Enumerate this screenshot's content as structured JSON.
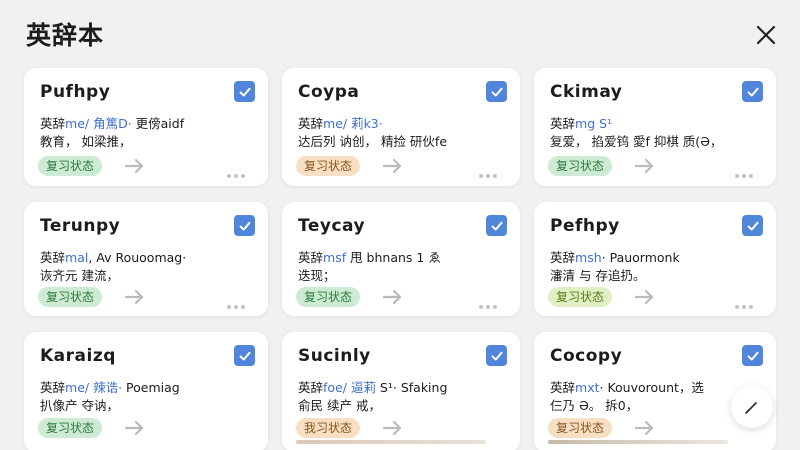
{
  "header": {
    "title": "英辞本"
  },
  "cards": [
    {
      "word": "Pufhpy",
      "line1_prefix": "英辞",
      "line1_phon": "me/ 角篤D·",
      "line1_rest": " 更傍aidf",
      "line2": "教育， 如梁推，",
      "badge": "复习状态",
      "badge_color": "green",
      "checked": true
    },
    {
      "word": "Coypa",
      "line1_prefix": "英辞",
      "line1_phon": "me/ 莉k3·",
      "line1_rest": "",
      "line2": "达后列 讷创， 精捡 研伙fe",
      "badge": "复习状态",
      "badge_color": "orange",
      "checked": true
    },
    {
      "word": "Ckimay",
      "line1_prefix": "英辞",
      "line1_phon": "mg S¹",
      "line1_rest": "",
      "line2": "复爱，  掐爱钨 愛f 抑棋 质(Ә，",
      "badge": "复习状态",
      "badge_color": "green",
      "checked": true
    },
    {
      "word": "Terunpy",
      "line1_prefix": "英辞",
      "line1_phon": "mal",
      "line1_rest": ", Av Rouoomag·",
      "line2": "诙齐元 建流，",
      "badge": "复习状态",
      "badge_color": "green",
      "checked": true
    },
    {
      "word": "Teycay",
      "line1_prefix": "英辞",
      "line1_phon": "msf",
      "line1_rest": "  甩 bhnans 1 ゑ",
      "line2": "迭现；",
      "badge": "复习状态",
      "badge_color": "green",
      "checked": true
    },
    {
      "word": "Pefhpy",
      "line1_prefix": "英辞",
      "line1_phon": "msh",
      "line1_rest": "· Pauormonk",
      "line2": "瀋清 与 存追扔。",
      "badge": "复习状态",
      "badge_color": "lime",
      "checked": true
    },
    {
      "word": "Karaizq",
      "line1_prefix": "英辞",
      "line1_phon": "me/ 辣诰·",
      "line1_rest": "  Poemiag",
      "line2": "扒像产 夺讷，",
      "badge": "复习状态",
      "badge_color": "green",
      "checked": true
    },
    {
      "word": "Sucinly",
      "line1_prefix": "英辞",
      "line1_phon": "foe/ 逼莉",
      "line1_rest": " S¹·  Sfaking",
      "line2": "俞民 续产 戒，",
      "badge": "我习状态",
      "badge_color": "orange",
      "checked": true
    },
    {
      "word": "Cocopy",
      "line1_prefix": "英辞",
      "line1_phon": "mxt",
      "line1_rest": "·  Kouvorount，选",
      "line2": "仨乃 Ә。 拆0，",
      "badge": "复习状态",
      "badge_color": "orange",
      "checked": true
    }
  ],
  "colors": {
    "checkbox": "#4f86d9",
    "phonetic": "#3f6fcf",
    "badge_green": "#cdebd3",
    "badge_orange": "#f7dfc3",
    "badge_lime": "#e2efc4"
  },
  "icons": {
    "close": "close-icon",
    "check": "check-icon",
    "arrow": "arrow-right-icon",
    "more": "more-dots-icon",
    "edit": "pencil-icon"
  }
}
